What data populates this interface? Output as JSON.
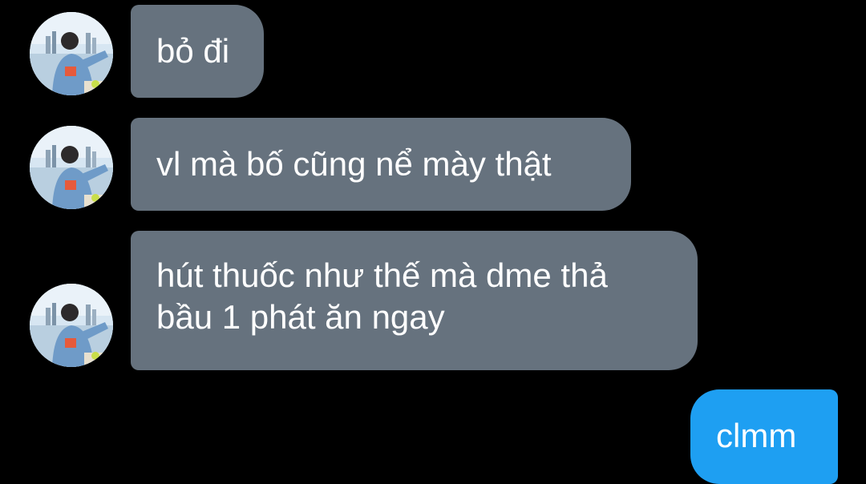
{
  "conversation": {
    "messages": [
      {
        "direction": "incoming",
        "text": "bỏ đi"
      },
      {
        "direction": "incoming",
        "text": "vl mà bố cũng nể mày thật"
      },
      {
        "direction": "incoming",
        "lines": [
          "hút thuốc như thế mà dme thả",
          "bầu 1 phát ăn ngay"
        ]
      },
      {
        "direction": "outgoing",
        "text": "clmm"
      }
    ]
  },
  "colors": {
    "background": "#000000",
    "incoming_bubble": "#66727e",
    "outgoing_bubble": "#1e9ff2",
    "text": "#ffffff"
  },
  "icons": {
    "contact_avatar": "avatar-photo"
  }
}
